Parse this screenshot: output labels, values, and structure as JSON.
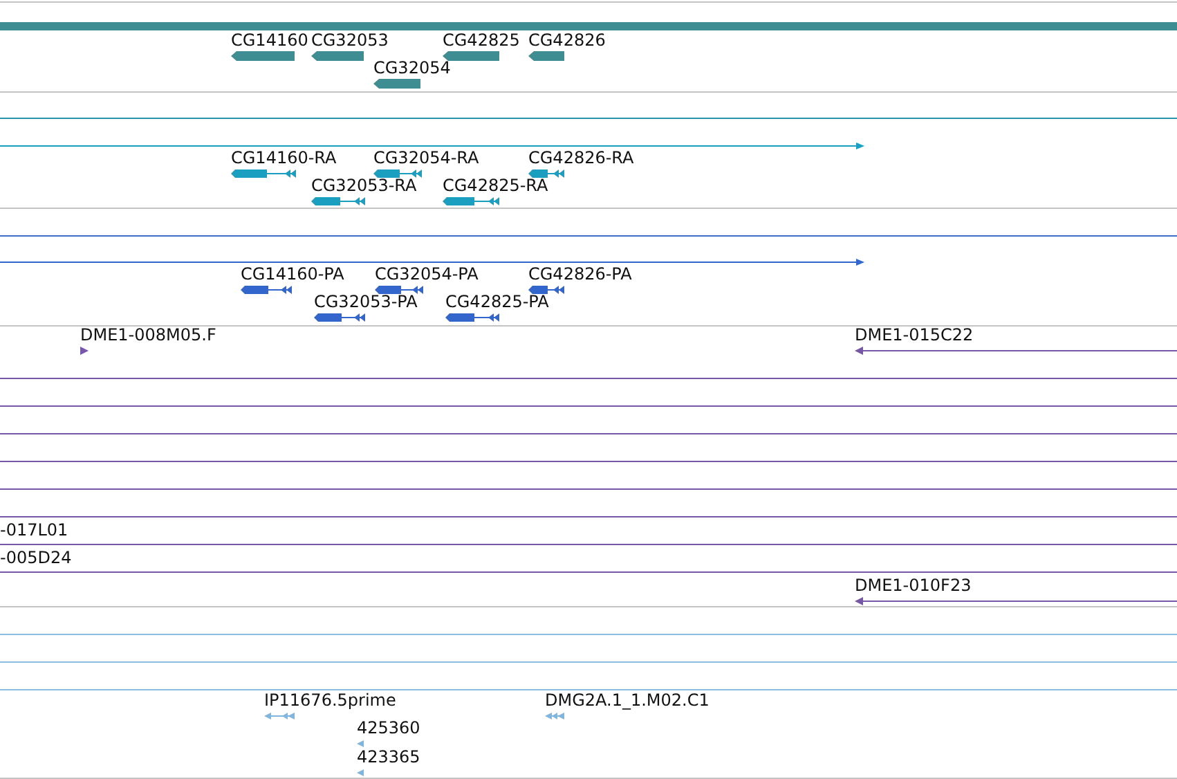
{
  "tracks": [
    {
      "kind": "gene",
      "color": "#3e8d92",
      "features": [
        {
          "label": "CG14160",
          "reverse": true
        },
        {
          "label": "CG32053",
          "reverse": true
        },
        {
          "label": "CG42825",
          "reverse": true
        },
        {
          "label": "CG42826",
          "reverse": true
        },
        {
          "label": "CG32054",
          "reverse": true
        }
      ]
    },
    {
      "kind": "transcript",
      "color": "#1a9fc0",
      "features": [
        {
          "label": "CG14160-RA",
          "reverse": true
        },
        {
          "label": "CG32054-RA",
          "reverse": true
        },
        {
          "label": "CG42826-RA",
          "reverse": true
        },
        {
          "label": "CG32053-RA",
          "reverse": true
        },
        {
          "label": "CG42825-RA",
          "reverse": true
        }
      ]
    },
    {
      "kind": "transcript",
      "color": "#3366cc",
      "features": [
        {
          "label": "CG14160-PA",
          "reverse": true
        },
        {
          "label": "CG32054-PA",
          "reverse": true
        },
        {
          "label": "CG42826-PA",
          "reverse": true
        },
        {
          "label": "CG32053-PA",
          "reverse": true
        },
        {
          "label": "CG42825-PA",
          "reverse": true
        }
      ]
    },
    {
      "kind": "clone",
      "color": "#7657a8",
      "features": [
        {
          "label": "DME1-008M05.F",
          "reverse": false
        },
        {
          "label": "DME1-015C22",
          "reverse": true
        },
        {
          "label": "-017L01"
        },
        {
          "label": "-005D24"
        },
        {
          "label": "DME1-010F23",
          "reverse": true
        }
      ]
    },
    {
      "kind": "est",
      "color": "#7fb6df",
      "features": [
        {
          "label": "IP11676.5prime",
          "reverse": true
        },
        {
          "label": "425360",
          "reverse": true
        },
        {
          "label": "423365",
          "reverse": true
        },
        {
          "label": "DMG2A.1_1.M02.C1",
          "reverse": true
        }
      ]
    }
  ]
}
